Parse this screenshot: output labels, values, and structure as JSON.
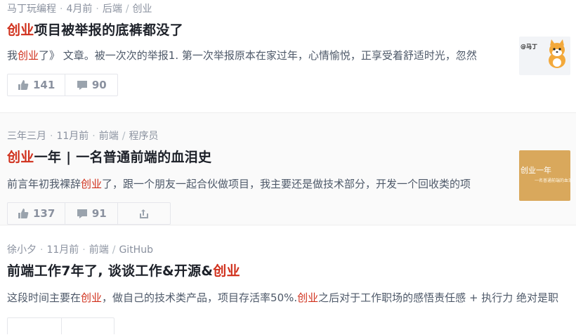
{
  "articles": [
    {
      "author": "马丁玩编程",
      "time": "4月前",
      "tags": [
        "后端",
        "创业"
      ],
      "title_hl": "创业",
      "title_rest": "项目被举报的底裤都没了",
      "excerpt_pre": "我",
      "excerpt_hl": "创业",
      "excerpt_post": "了》 文章。被一次次的举报1. 第一次举报原本在家过年，心情愉悦，正享受着舒适时光，忽然",
      "likes": "141",
      "comments": "90",
      "thumb_text": "@马丁"
    },
    {
      "author": "三年三月",
      "time": "11月前",
      "tags": [
        "前端",
        "程序员"
      ],
      "title_hl": "创业",
      "title_rest": "一年 | 一名普通前端的血泪史",
      "excerpt_pre": "前言年初我裸辞",
      "excerpt_hl": "创业",
      "excerpt_post": "了，跟一个朋友一起合伙做项目，我主要还是做技术部分，开发一个回收类的项",
      "likes": "137",
      "comments": "91",
      "thumb_text": "创业一年",
      "thumb_sub": "一名普通前端的血泪"
    },
    {
      "author": "徐小夕",
      "time": "11月前",
      "tags": [
        "前端",
        "GitHub"
      ],
      "title_pre": "前端工作7年了, 谈谈工作&开源&",
      "title_hl": "创业",
      "excerpt_pre": "这段时间主要在",
      "excerpt_hl": "创业",
      "excerpt_mid": "，做自己的技术类产品，项目存活率50%.",
      "excerpt_hl2": "创业",
      "excerpt_post": "之后对于工作职场的感悟责任感 + 执行力 绝对是职"
    }
  ],
  "colors": {
    "highlight": "#d0301c",
    "meta": "#8a919f"
  }
}
